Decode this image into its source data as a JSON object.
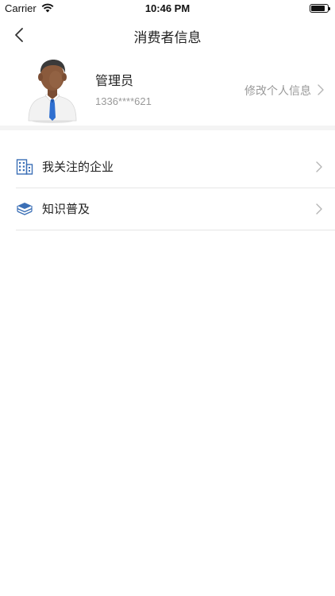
{
  "status_bar": {
    "carrier": "Carrier",
    "time": "10:46 PM",
    "battery_level": 0.85
  },
  "nav": {
    "title": "消费者信息"
  },
  "profile": {
    "name": "管理员",
    "phone": "1336****621",
    "edit_label": "修改个人信息"
  },
  "menu": {
    "items": [
      {
        "label": "我关注的企业",
        "icon": "building-icon"
      },
      {
        "label": "知识普及",
        "icon": "stacked-books-icon"
      }
    ]
  },
  "colors": {
    "icon_blue": "#3b6fb6",
    "secondary_text": "#999999",
    "divider": "#e6e6e6"
  }
}
